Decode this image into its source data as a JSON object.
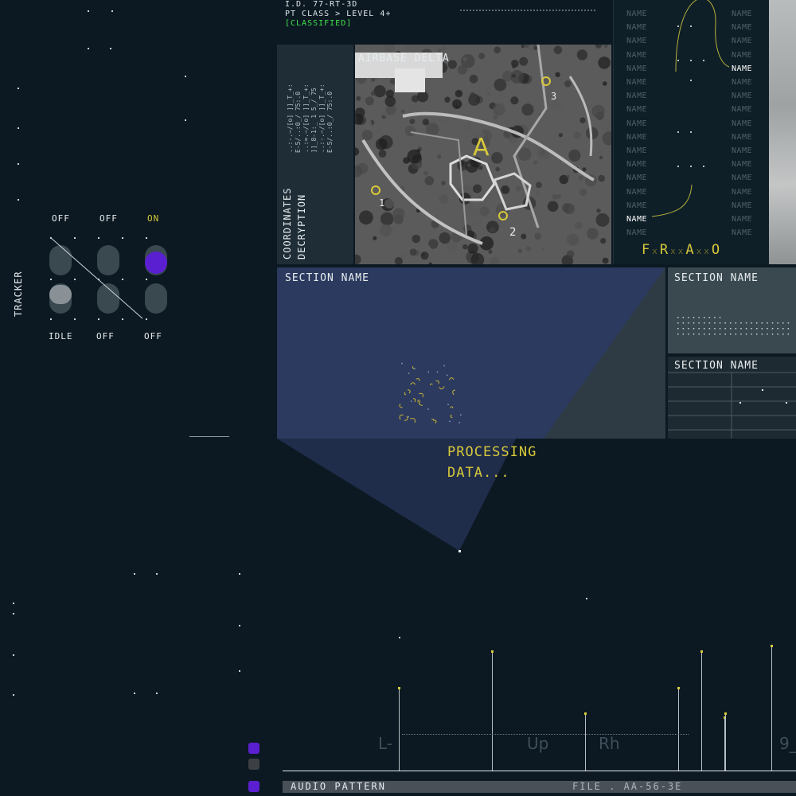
{
  "header": {
    "id_line": "I.D. 77-RT-3D",
    "class_line": "PT CLASS > LEVEL 4+",
    "status": "[CLASSIFIED]",
    "status_color": "#3ee04a"
  },
  "coordinates_panel": {
    "title_line1": "COORDINATES",
    "title_line2": "DECRYPTION",
    "code_lines": [
      "..:-.~/[o] ]]_T_+:",
      "E-5/..:0_/ 75:.0",
      "..:=.~/[o] ]]_T_+:",
      "]]_8-1:_ 1  5_/ 75",
      "..:-.~/[o] ]]_T_+:",
      "E-5/..:0_/ 75:.0"
    ]
  },
  "map": {
    "title": "AIRBASE DELTA",
    "markers": [
      {
        "label": "A"
      },
      {
        "label": "1"
      },
      {
        "label": "2"
      },
      {
        "label": "3"
      }
    ]
  },
  "names_panel": {
    "left_column": [
      "NAME",
      "NAME",
      "NAME",
      "NAME",
      "NAME",
      "NAME",
      "NAME",
      "NAME",
      "NAME",
      "NAME",
      "NAME",
      "NAME",
      "NAME",
      "NAME",
      "NAME",
      "NAME",
      "NAME"
    ],
    "right_column": [
      "NAME",
      "NAME",
      "NAME",
      "NAME",
      "NAME",
      "NAME",
      "NAME",
      "NAME",
      "NAME",
      "NAME",
      "NAME",
      "NAME",
      "NAME",
      "NAME",
      "NAME",
      "NAME",
      "NAME"
    ],
    "highlight_left_index": 15,
    "highlight_right_index": 4,
    "code": [
      "F",
      "x",
      "R",
      "x",
      "x",
      "A",
      "x",
      "x",
      "O"
    ]
  },
  "sections": {
    "main_title": "SECTION NAME",
    "right1_title": "SECTION NAME",
    "right2_title": "SECTION NAME"
  },
  "processing": {
    "line1": "PROCESSING",
    "line2": "DATA..."
  },
  "tracker": {
    "title": "TRACKER",
    "top_labels": [
      "OFF",
      "OFF",
      "ON"
    ],
    "bottom_labels": [
      "IDLE",
      "OFF",
      "OFF"
    ],
    "active_index": 2,
    "accent_color": "#5a1fd1",
    "highlight_color": "#d8c93a"
  },
  "audio": {
    "label": "AUDIO PATTERN",
    "file": "FILE . AA-56-3E",
    "axis_labels": [
      "L-",
      "Up",
      "Rh",
      "9_"
    ],
    "bar_levels": [
      0.61,
      0.88,
      0.42,
      0.61,
      0.88,
      0.39,
      0.92,
      0.42
    ],
    "square_colors": [
      "#5a1fd1",
      "#3c3f44",
      "#5a1fd1"
    ]
  }
}
